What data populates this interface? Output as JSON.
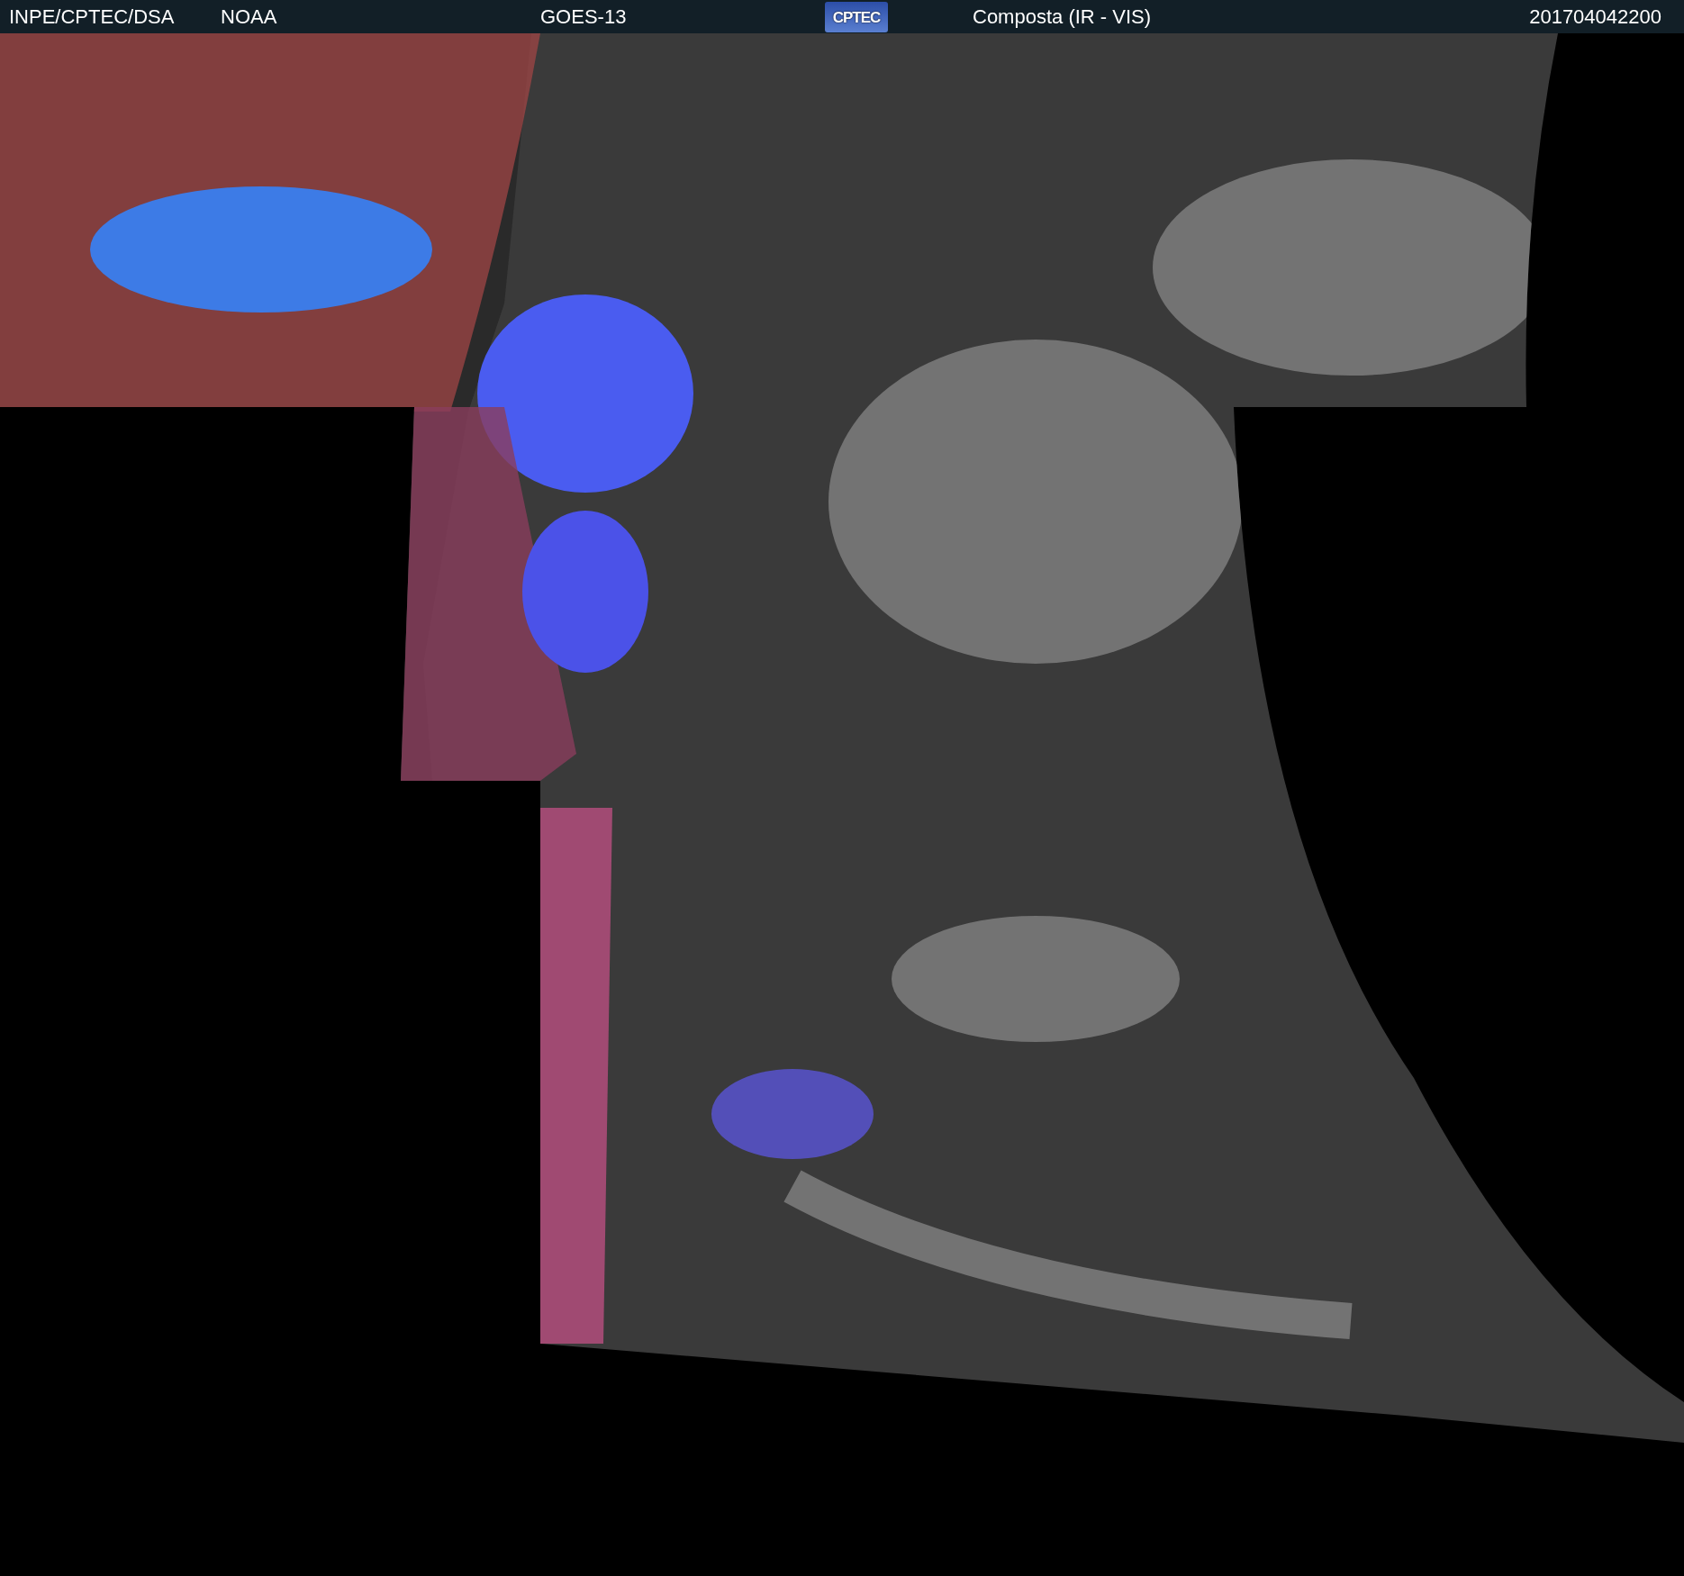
{
  "header": {
    "source": "INPE/CPTEC/DSA",
    "agency": "NOAA",
    "satellite": "GOES-13",
    "logo": "CPTEC",
    "product": "Composta (IR - VIS)",
    "timestamp": "201704042200"
  }
}
